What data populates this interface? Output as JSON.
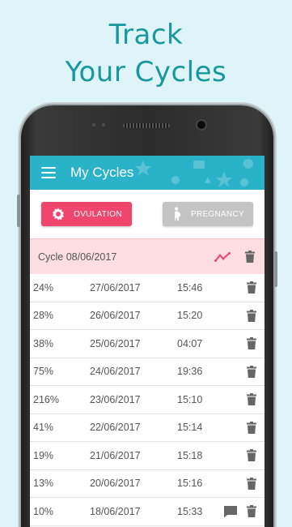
{
  "promo": {
    "line1": "Track",
    "line2": "Your Cycles"
  },
  "app": {
    "title": "My Cycles",
    "tabs": {
      "ovulation_label": "OVULATION",
      "pregnancy_label": "PREGNANCY"
    },
    "cycle": {
      "title": "Cycle 08/06/2017"
    },
    "rows": [
      {
        "pct": "24%",
        "date": "27/06/2017",
        "time": "15:46",
        "note": false
      },
      {
        "pct": "28%",
        "date": "26/06/2017",
        "time": "15:20",
        "note": false
      },
      {
        "pct": "38%",
        "date": "25/06/2017",
        "time": "04:07",
        "note": false
      },
      {
        "pct": "75%",
        "date": "24/06/2017",
        "time": "19:36",
        "note": false
      },
      {
        "pct": "216%",
        "date": "23/06/2017",
        "time": "15:10",
        "note": false
      },
      {
        "pct": "41%",
        "date": "22/06/2017",
        "time": "15:14",
        "note": false
      },
      {
        "pct": "19%",
        "date": "21/06/2017",
        "time": "15:18",
        "note": false
      },
      {
        "pct": "13%",
        "date": "20/06/2017",
        "time": "15:16",
        "note": false
      },
      {
        "pct": "10%",
        "date": "18/06/2017",
        "time": "15:33",
        "note": true
      }
    ]
  },
  "colors": {
    "page_bg": "#dff4f8",
    "headline": "#17979e",
    "appbar": "#2ab3c8",
    "ovulation": "#f0456c",
    "pregnancy": "#c4c4c4",
    "cycle_header": "#fbdde2"
  },
  "icons": {
    "menu": "hamburger-icon",
    "ovulation": "gear-flower-icon",
    "pregnancy": "pregnant-woman-icon",
    "trend": "trending-up-icon",
    "delete": "trash-icon",
    "note": "comment-icon"
  }
}
